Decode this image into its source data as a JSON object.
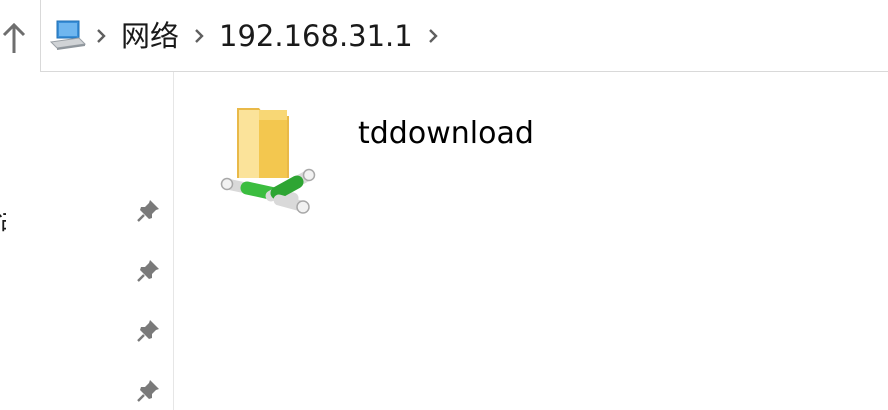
{
  "toolbar": {
    "up_icon": "arrow-up-icon"
  },
  "address_bar": {
    "root_icon": "network-computer-icon",
    "separator_icon": "chevron-right-icon",
    "crumbs": [
      "网络",
      "192.168.31.1"
    ]
  },
  "nav_pane": {
    "partial_label": "问",
    "pin_icon": "pin-icon"
  },
  "content": {
    "items": [
      {
        "name": "tddownload",
        "icon": "network-share-folder-icon"
      }
    ]
  },
  "colors": {
    "icon_gray": "#7a7a7a",
    "folder_yellow": "#f5cd5b",
    "pipe_green": "#3bbd3f"
  }
}
